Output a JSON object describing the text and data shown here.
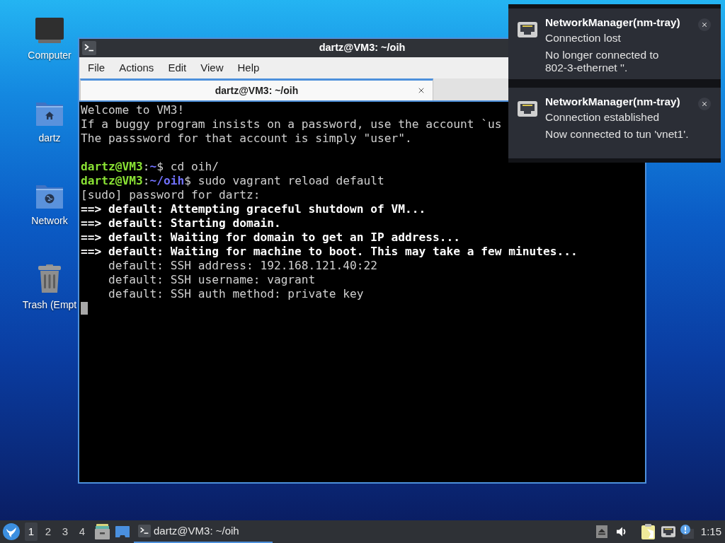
{
  "desktop": {
    "icons": [
      {
        "kind": "computer",
        "label": "Computer"
      },
      {
        "kind": "home",
        "label": "dartz"
      },
      {
        "kind": "network",
        "label": "Network"
      },
      {
        "kind": "trash",
        "label": "Trash (Empt"
      }
    ]
  },
  "terminal_window": {
    "title": "dartz@VM3: ~/oih",
    "menu": [
      "File",
      "Actions",
      "Edit",
      "View",
      "Help"
    ],
    "tabs": [
      {
        "label": "dartz@VM3: ~/oih",
        "selected": true
      }
    ],
    "paragraphs": [
      {
        "lines": [
          {
            "segments": [
              {
                "kind": "output",
                "text": "Welcome to VM3!"
              }
            ]
          },
          {
            "segments": [
              {
                "kind": "output",
                "text": "If a buggy program insists on a password, use the account `us"
              }
            ]
          },
          {
            "segments": [
              {
                "kind": "output",
                "text": "The passsword for that account is simply \"user\"."
              }
            ]
          }
        ]
      },
      {
        "lines": [
          {
            "segments": [
              {
                "kind": "user",
                "text": "dartz@VM3"
              },
              {
                "kind": "output",
                "text": ":"
              },
              {
                "kind": "path",
                "text": "~"
              },
              {
                "kind": "output",
                "text": "$ cd oih/"
              }
            ]
          },
          {
            "segments": [
              {
                "kind": "user",
                "text": "dartz@VM3"
              },
              {
                "kind": "output",
                "text": ":"
              },
              {
                "kind": "path",
                "text": "~/oih"
              },
              {
                "kind": "output",
                "text": "$ sudo vagrant reload default"
              }
            ]
          },
          {
            "segments": [
              {
                "kind": "output",
                "text": "[sudo] password for dartz:"
              }
            ]
          },
          {
            "segments": [
              {
                "kind": "status",
                "text": "==> default: Attempting graceful shutdown of VM..."
              }
            ]
          },
          {
            "segments": [
              {
                "kind": "status",
                "text": "==> default: Starting domain."
              }
            ]
          },
          {
            "segments": [
              {
                "kind": "status",
                "text": "==> default: Waiting for domain to get an IP address..."
              }
            ]
          },
          {
            "segments": [
              {
                "kind": "status",
                "text": "==> default: Waiting for machine to boot. This may take a few minutes..."
              }
            ]
          },
          {
            "segments": [
              {
                "kind": "output",
                "text": "    default: SSH address: 192.168.121.40:22"
              }
            ]
          },
          {
            "segments": [
              {
                "kind": "output",
                "text": "    default: SSH username: vagrant"
              }
            ]
          },
          {
            "segments": [
              {
                "kind": "output",
                "text": "    default: SSH auth method: private key"
              }
            ]
          }
        ]
      }
    ]
  },
  "notifications": [
    {
      "app": "NetworkManager(nm-tray)",
      "summary": "Connection lost",
      "body": "No longer connected to 802-3-ethernet ''."
    },
    {
      "app": "NetworkManager(nm-tray)",
      "summary": "Connection established",
      "body": "Now connected to tun 'vnet1'."
    }
  ],
  "taskbar": {
    "workspaces": [
      {
        "label": "1",
        "selected": true
      },
      {
        "label": "2",
        "selected": false
      },
      {
        "label": "3",
        "selected": false
      },
      {
        "label": "4",
        "selected": false
      }
    ],
    "tasks": [
      {
        "label": "dartz@VM3: ~/oih",
        "selected": true
      }
    ],
    "clock": "1:15"
  }
}
